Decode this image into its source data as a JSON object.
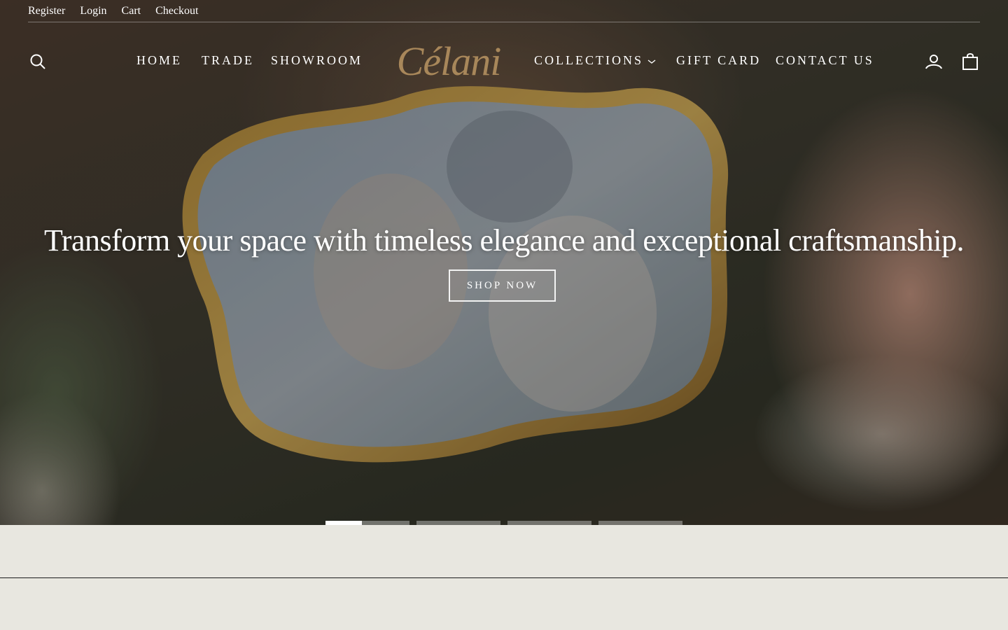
{
  "utility_links": [
    "Register",
    "Login",
    "Cart",
    "Checkout"
  ],
  "brand": {
    "logo_text": "Célani",
    "logo_color": "#a8875a"
  },
  "nav": {
    "left": [
      "HOME",
      "TRADE",
      "SHOWROOM"
    ],
    "right": [
      "COLLECTIONS",
      "GIFT CARD",
      "CONTACT US"
    ]
  },
  "icons": {
    "search": "search-icon",
    "account": "account-icon",
    "cart": "bag-icon",
    "dropdown": "chevron-down-icon"
  },
  "hero": {
    "headline": "Transform your space with timeless elegance and exceptional craftsmanship.",
    "cta_label": "SHOP NOW"
  },
  "slider": {
    "slide_count": 4,
    "active_index": 0,
    "active_progress": 0.43
  },
  "colors": {
    "page_background": "#e8e7e0",
    "accent_gold": "#a8875a"
  }
}
